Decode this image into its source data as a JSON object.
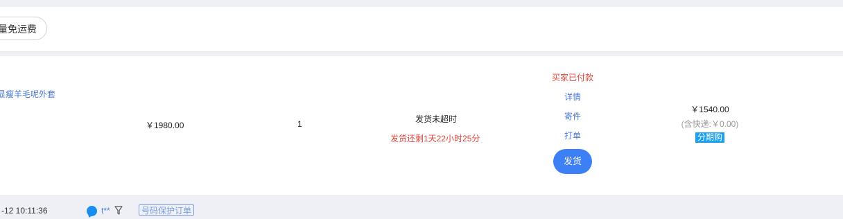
{
  "toolbar": {
    "bulk_free_shipping_label": "量免运费"
  },
  "order": {
    "product_title": "显瘦羊毛呢外套",
    "unit_price": "￥1980.00",
    "quantity": "1",
    "ship_status": "发货未超时",
    "ship_remaining": "发货还剩1天22小时25分",
    "payment_status": "买家已付款",
    "actions": {
      "details": "详情",
      "mail": "寄件",
      "print": "打单",
      "ship": "发货"
    },
    "total_amount": "￥1540.00",
    "shipping_fee": "(含快递:￥0.00)",
    "installment_badge": "分期购"
  },
  "footer": {
    "order_time": "-12 10:11:36",
    "buyer_name": "t**",
    "protect_badge": "号码保护订单"
  },
  "icons": {
    "chat": "chat-bubble-icon",
    "filter": "filter-icon"
  },
  "colors": {
    "accent_blue": "#3d7ff5",
    "link_blue": "#4a7bd8",
    "alert_red": "#e0463a",
    "installment_blue": "#1aa0f0"
  }
}
